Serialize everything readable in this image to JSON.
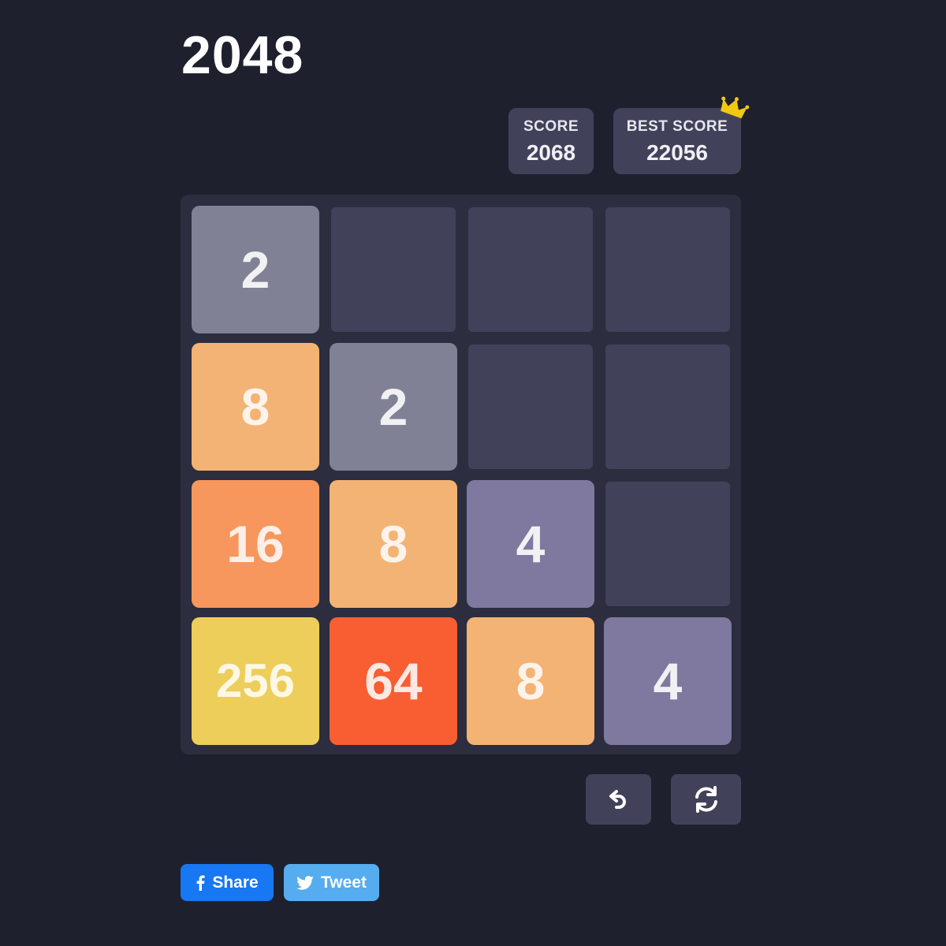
{
  "header": {
    "title": "2048"
  },
  "scores": {
    "score_label": "SCORE",
    "score_value": "2068",
    "best_label": "BEST SCORE",
    "best_value": "22056",
    "best_badge_icon": "crown-icon",
    "crown_color": "#f2c811"
  },
  "board": {
    "size": 4,
    "empty_cell_color": "#41425a",
    "background_color": "#2c2d3e",
    "grid": [
      [
        2,
        null,
        null,
        null
      ],
      [
        8,
        2,
        null,
        null
      ],
      [
        16,
        8,
        4,
        null
      ],
      [
        256,
        64,
        8,
        4
      ]
    ],
    "tile_colors": {
      "2": "#818196",
      "4": "#7f79a0",
      "8": "#f3b374",
      "16": "#f7975d",
      "64": "#f95d32",
      "256": "#edce5b"
    },
    "tile_text_colors": {
      "2": "#f1f1f4",
      "4": "#f1f1f4",
      "8": "#fdf3ea",
      "16": "#fdefe8",
      "64": "#fde8e2",
      "256": "#fdf8e4"
    }
  },
  "controls": {
    "undo_icon": "undo-icon",
    "restart_icon": "restart-icon"
  },
  "social": {
    "share_label": "Share",
    "share_icon": "facebook-icon",
    "share_color": "#1877f2",
    "tweet_label": "Tweet",
    "tweet_icon": "twitter-icon",
    "tweet_color": "#55acee"
  }
}
